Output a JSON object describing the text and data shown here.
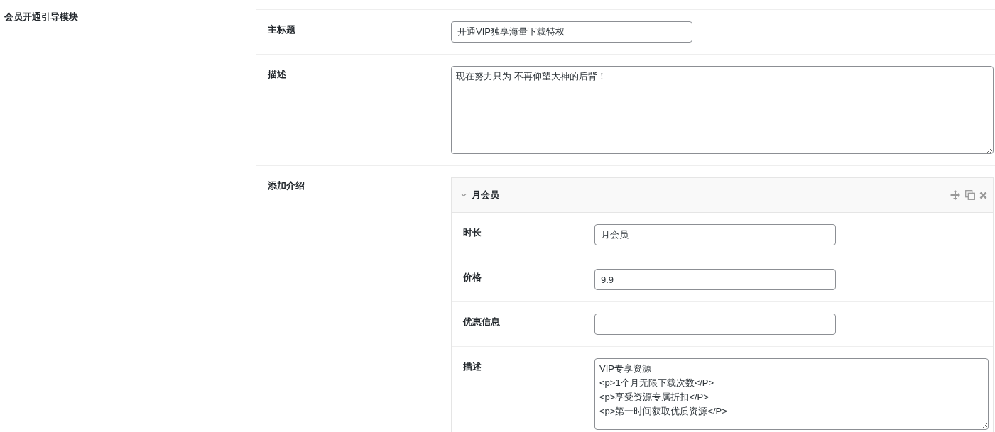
{
  "section": {
    "title": "会员开通引导模块"
  },
  "fields": [
    {
      "label": "主标题",
      "kind": "input",
      "value": "开通VIP独享海量下载特权"
    },
    {
      "label": "描述",
      "kind": "textarea",
      "value": "现在努力只为 不再仰望大神的后背！"
    }
  ],
  "repeater": {
    "label": "添加介绍",
    "items": [
      {
        "title": "月会员",
        "expanded": true,
        "fields": [
          {
            "label": "时长",
            "kind": "input",
            "value": "月会员"
          },
          {
            "label": "价格",
            "kind": "input",
            "value": "9.9"
          },
          {
            "label": "优惠信息",
            "kind": "input"
          },
          {
            "label": "描述",
            "kind": "textarea",
            "value": "VIP专享资源\n<p>1个月无限下载次数</P>\n<p>享受资源专属折扣</P>\n<p>第一时间获取优质资源</P>"
          }
        ]
      }
    ]
  }
}
